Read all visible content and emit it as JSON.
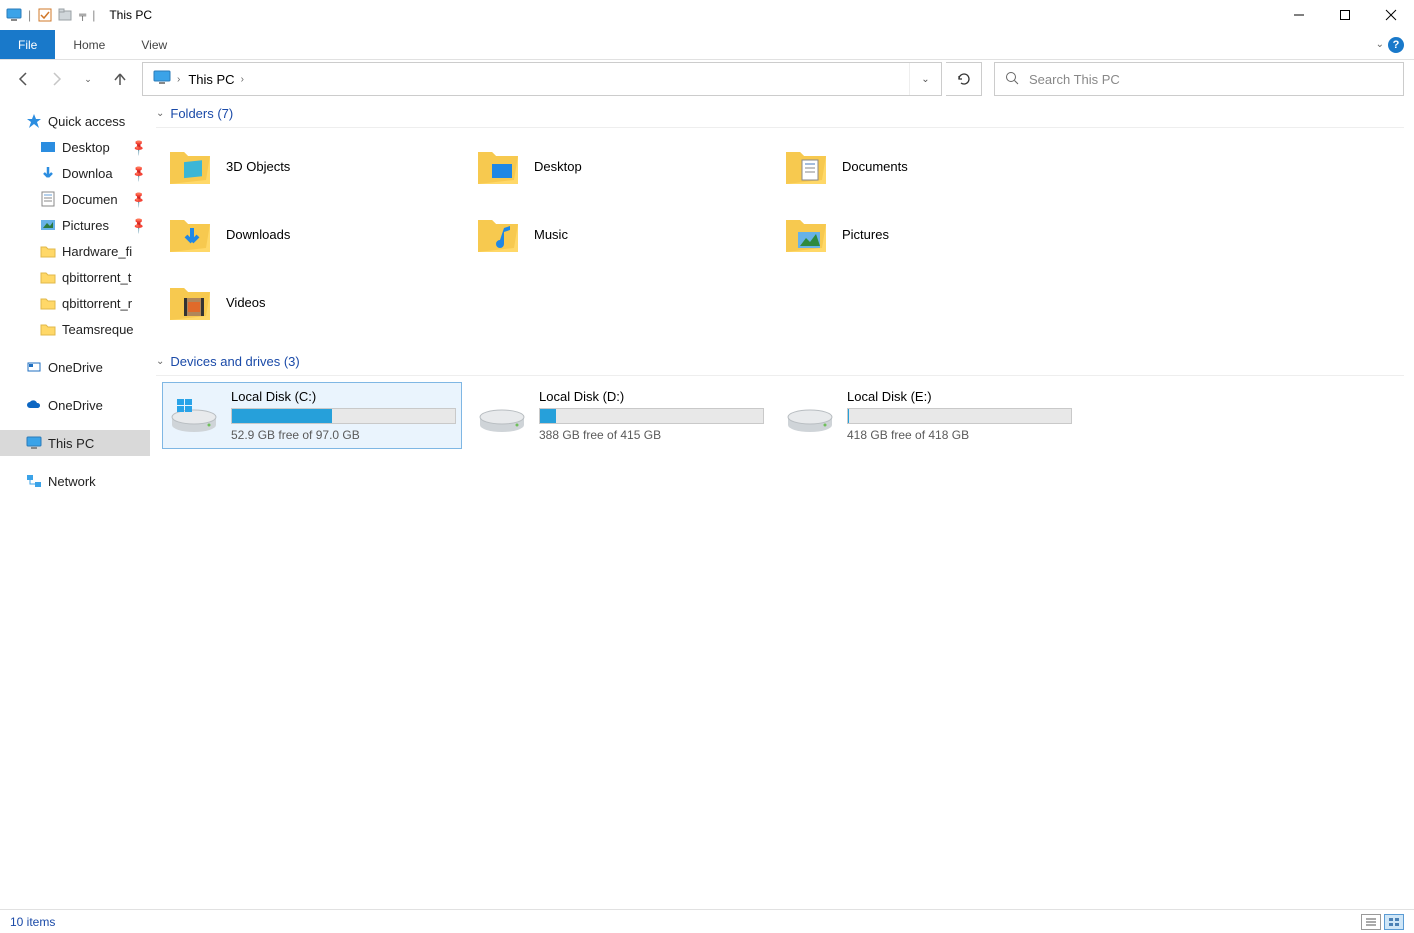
{
  "window": {
    "title": "This PC"
  },
  "ribbon": {
    "file": "File",
    "home": "Home",
    "view": "View"
  },
  "nav": {
    "address_location": "This PC",
    "search_placeholder": "Search This PC"
  },
  "sidebar": {
    "quick_access": "Quick access",
    "quick_items": [
      {
        "label": "Desktop",
        "pinned": true
      },
      {
        "label": "Downloa",
        "pinned": true
      },
      {
        "label": "Documen",
        "pinned": true
      },
      {
        "label": "Pictures",
        "pinned": true
      },
      {
        "label": "Hardware_fi",
        "pinned": false
      },
      {
        "label": "qbittorrent_t",
        "pinned": false
      },
      {
        "label": "qbittorrent_r",
        "pinned": false
      },
      {
        "label": "Teamsreque",
        "pinned": false
      }
    ],
    "onedrive1": "OneDrive",
    "onedrive2": "OneDrive",
    "this_pc": "This PC",
    "network": "Network"
  },
  "groups": {
    "folders_header": "Folders (7)",
    "drives_header": "Devices and drives (3)"
  },
  "folders": [
    {
      "label": "3D Objects"
    },
    {
      "label": "Desktop"
    },
    {
      "label": "Documents"
    },
    {
      "label": "Downloads"
    },
    {
      "label": "Music"
    },
    {
      "label": "Pictures"
    },
    {
      "label": "Videos"
    }
  ],
  "drives": [
    {
      "label": "Local Disk (C:)",
      "free_text": "52.9 GB free of 97.0 GB",
      "used_pct": 45,
      "selected": true,
      "os": true
    },
    {
      "label": "Local Disk (D:)",
      "free_text": "388 GB free of 415 GB",
      "used_pct": 7,
      "selected": false,
      "os": false
    },
    {
      "label": "Local Disk (E:)",
      "free_text": "418 GB free of 418 GB",
      "used_pct": 0.5,
      "selected": false,
      "os": false
    }
  ],
  "status": {
    "items_text": "10 items"
  }
}
